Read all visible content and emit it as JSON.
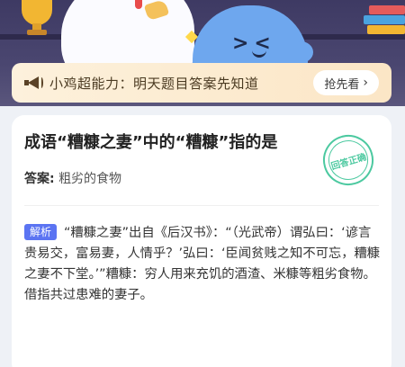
{
  "promo": {
    "text": "小鸡超能力：明天题目答案先知道",
    "button_label": "抢先看",
    "chevron": "›"
  },
  "card": {
    "question": "成语“糟糠之妻”中的“糟糠”指的是",
    "answer_label": "答案:",
    "answer_text": "粗劣的食物",
    "stamp_text": "回答正确",
    "analysis_tag": "解析",
    "analysis_text": "“糟糠之妻”出自《后汉书》：“（光武帝）谓弘曰：‘谚言贵易交，富易妻，人情乎？’弘曰：‘臣闻贫贱之知不可忘，糟糠之妻不下堂。’”糟糠：穷人用来充饥的酒渣、米糠等粗劣食物。借指共过患难的妻子。"
  },
  "colors": {
    "accent_blue": "#5b74f2",
    "stamp_green": "#4cc9a0",
    "promo_bg": "#fdf1dc"
  },
  "icons": {
    "promo": "megaphone-icon",
    "button": "chevron-right-icon",
    "stamp": "correct-stamp-icon"
  }
}
